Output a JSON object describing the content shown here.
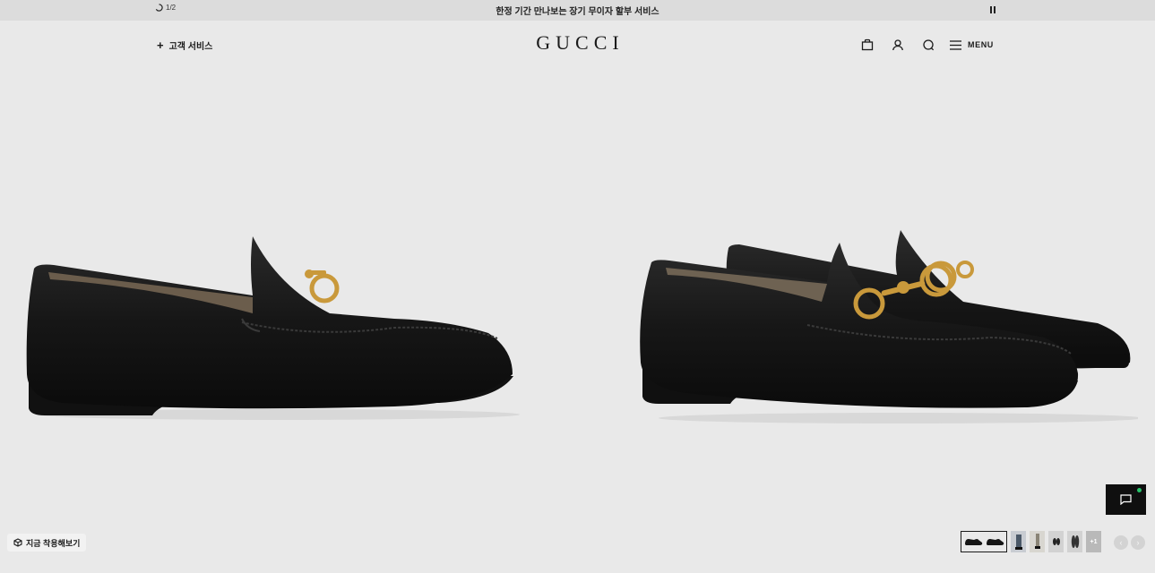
{
  "announcement": {
    "counter": "1/2",
    "text": "한정 기간 만나보는 장기 무이자 할부 서비스"
  },
  "header": {
    "customer_service": "고객 서비스",
    "logo": "GUCCI",
    "menu_label": "MENU"
  },
  "product": {
    "try_on_label": "지금 착용해보기",
    "thumbnail_more": "+1"
  },
  "colors": {
    "background": "#e9e9e9",
    "announcement_bg": "#dcdcdc",
    "chat_bg": "#0f0f0f",
    "chat_status": "#27c36a",
    "hardware_gold": "#c9993b"
  },
  "icons": [
    "loading-icon",
    "pause-icon",
    "plus-icon",
    "bag-icon",
    "user-icon",
    "search-icon",
    "menu-icon",
    "cube-icon",
    "chat-icon",
    "chevron-left-icon",
    "chevron-right-icon"
  ]
}
